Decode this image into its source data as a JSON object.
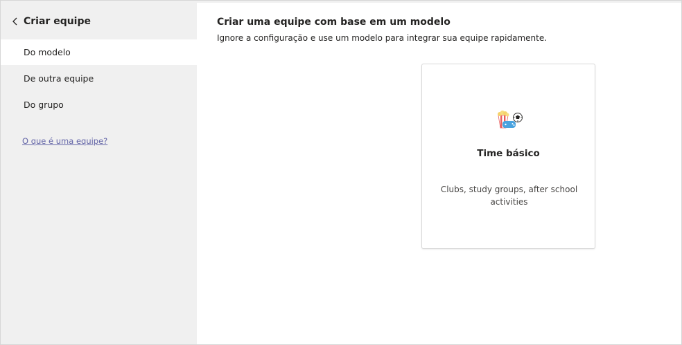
{
  "sidebar": {
    "back_title": "Criar equipe",
    "items": [
      {
        "label": "Do modelo",
        "selected": true
      },
      {
        "label": "De outra equipe",
        "selected": false
      },
      {
        "label": "Do grupo",
        "selected": false
      }
    ],
    "help_link": "O que é uma equipe?"
  },
  "main": {
    "title": "Criar uma equipe com base em um modelo",
    "subtitle": "Ignore a configuração e use um modelo para integrar sua equipe rapidamente."
  },
  "template_card": {
    "icon": "club-activities-icon",
    "title": "Time básico",
    "description": "Clubs, study groups, after school activities"
  },
  "colors": {
    "sidebar_bg": "#f0f0f0",
    "selected_bg": "#ffffff",
    "link": "#6264a7",
    "text": "#252423"
  }
}
